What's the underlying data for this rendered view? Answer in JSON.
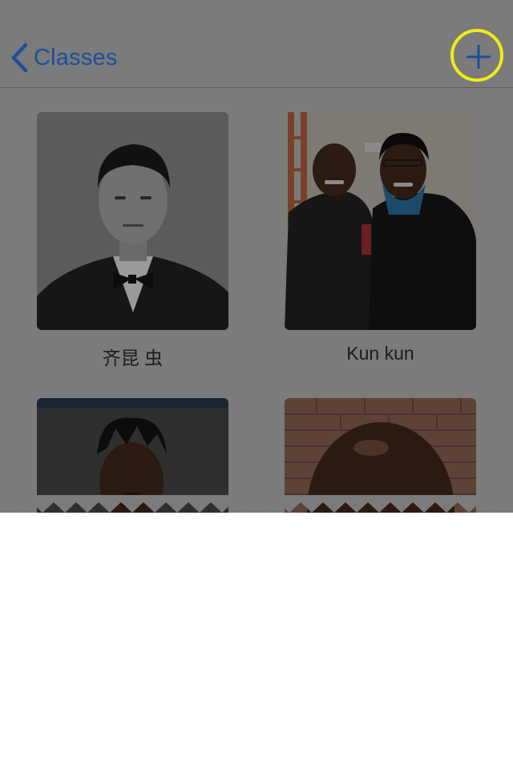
{
  "nav": {
    "back_label": "Classes",
    "back_icon": "chevron-left-icon",
    "add_icon": "plus-icon",
    "accent_color": "#1e4e98",
    "highlight_color": "#ecec16"
  },
  "students": [
    {
      "name": "齐昆 虫"
    },
    {
      "name": "Kun kun"
    },
    {
      "name": ""
    },
    {
      "name": ""
    }
  ]
}
